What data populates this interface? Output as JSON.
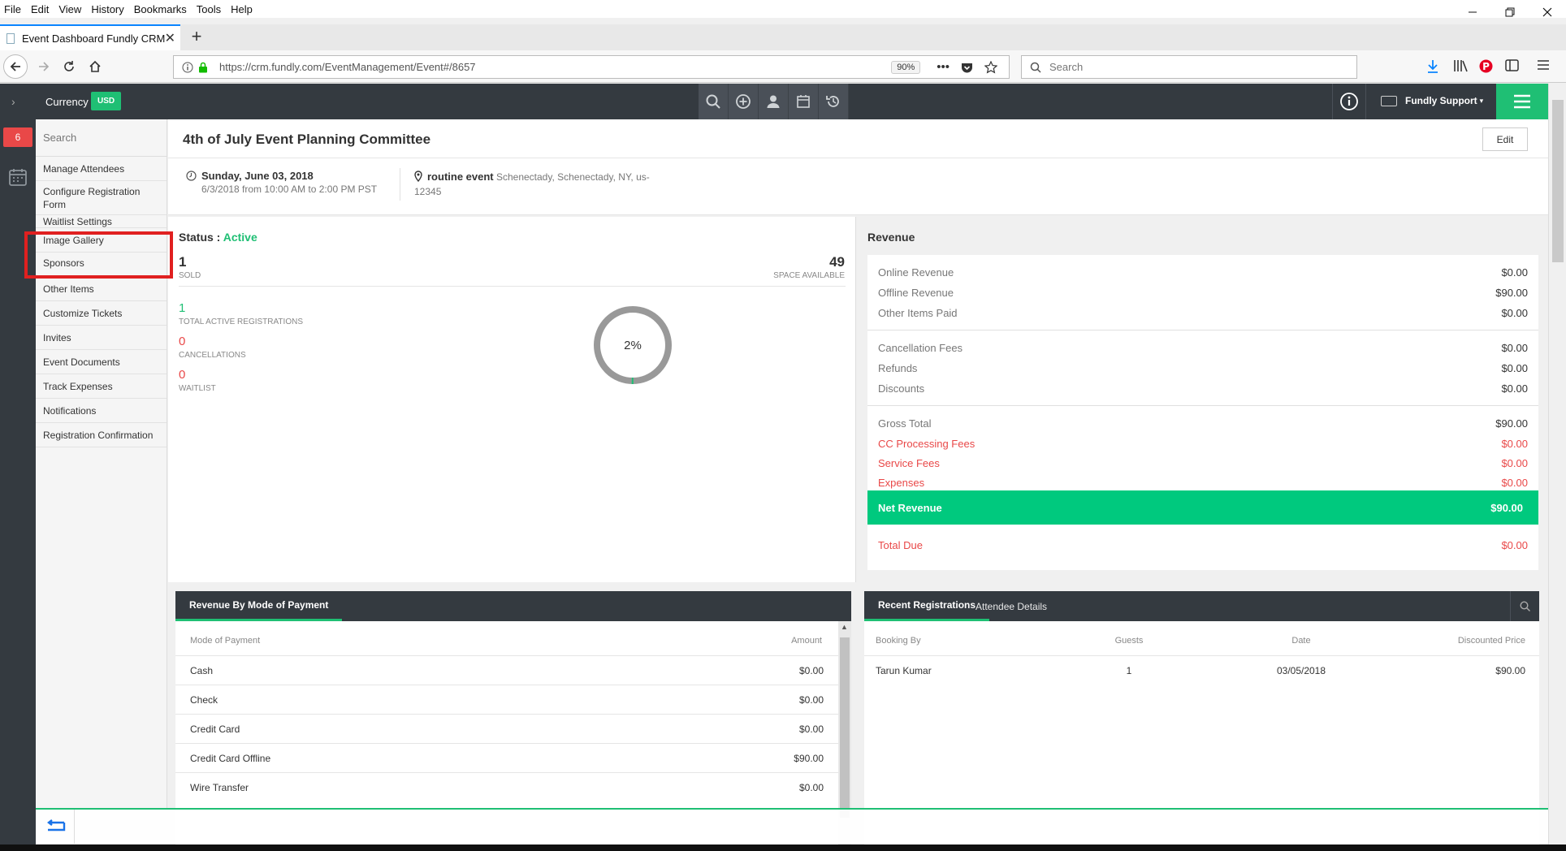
{
  "browser": {
    "menu": [
      "File",
      "Edit",
      "View",
      "History",
      "Bookmarks",
      "Tools",
      "Help"
    ],
    "tab_title": "Event Dashboard Fundly CRM",
    "url": "https://crm.fundly.com/EventManagement/Event#/8657",
    "zoom": "90%",
    "search_placeholder": "Search"
  },
  "topbar": {
    "currency_label": "Currency",
    "currency_value": "USD",
    "user": "Fundly Support",
    "accent": "#1fbf74"
  },
  "rail": {
    "notification_count": "6"
  },
  "subnav": {
    "search_placeholder": "Search",
    "items": [
      "Manage Attendees",
      "Configure Registration Form",
      "Waitlist Settings",
      "Image Gallery",
      "Sponsors",
      "Other Items",
      "Customize Tickets",
      "Invites",
      "Event Documents",
      "Track Expenses",
      "Notifications",
      "Registration Confirmation"
    ]
  },
  "event": {
    "title": "4th of July Event Planning Committee",
    "edit_label": "Edit",
    "date": "Sunday, June 03, 2018",
    "time": "6/3/2018 from 10:00 AM to 2:00 PM PST",
    "location_name": "routine event",
    "location_address": "Schenectady, Schenectady, NY, us-12345"
  },
  "status": {
    "label": "Status :",
    "value": "Active",
    "sold": "1",
    "sold_label": "SOLD",
    "space": "49",
    "space_label": "SPACE AVAILABLE",
    "percent_label": "2%",
    "percent_value": 2,
    "metrics": [
      {
        "value": "1",
        "label": "TOTAL ACTIVE REGISTRATIONS",
        "color": "#1fbf74"
      },
      {
        "value": "0",
        "label": "CANCELLATIONS",
        "color": "#e94848"
      },
      {
        "value": "0",
        "label": "WAITLIST",
        "color": "#e94848"
      }
    ]
  },
  "revenue": {
    "title": "Revenue",
    "rows": [
      {
        "label": "Online Revenue",
        "value": "$0.00"
      },
      {
        "label": "Offline Revenue",
        "value": "$90.00"
      },
      {
        "label": "Other Items Paid",
        "value": "$0.00"
      },
      {
        "label": "Cancellation Fees",
        "value": "$0.00"
      },
      {
        "label": "Refunds",
        "value": "$0.00"
      },
      {
        "label": "Discounts",
        "value": "$0.00"
      },
      {
        "label": "Gross Total",
        "value": "$90.00"
      },
      {
        "label": "CC Processing Fees",
        "value": "$0.00"
      },
      {
        "label": "Service Fees",
        "value": "$0.00"
      },
      {
        "label": "Expenses",
        "value": "$0.00"
      }
    ],
    "net_label": "Net Revenue",
    "net_value": "$90.00",
    "due_label": "Total Due",
    "due_value": "$0.00"
  },
  "payment_panel": {
    "tab": "Revenue By Mode of Payment",
    "col_mode": "Mode of Payment",
    "col_amount": "Amount",
    "rows": [
      {
        "mode": "Cash",
        "amount": "$0.00"
      },
      {
        "mode": "Check",
        "amount": "$0.00"
      },
      {
        "mode": "Credit Card",
        "amount": "$0.00"
      },
      {
        "mode": "Credit Card Offline",
        "amount": "$90.00"
      },
      {
        "mode": "Wire Transfer",
        "amount": "$0.00"
      }
    ]
  },
  "registrations_panel": {
    "tab_active": "Recent Registrations",
    "tab_inactive": "Attendee Details",
    "cols": [
      "Booking By",
      "Guests",
      "Date",
      "Discounted Price"
    ],
    "rows": [
      {
        "booking_by": "Tarun Kumar",
        "guests": "1",
        "date": "03/05/2018",
        "price": "$90.00"
      }
    ]
  }
}
